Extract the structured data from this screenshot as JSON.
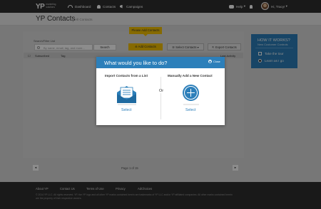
{
  "app": {
    "logo": "YP",
    "logo_sub_1": "marketing",
    "logo_sub_2": "solutions"
  },
  "nav": {
    "items": [
      {
        "label": "Dashboard",
        "icon": "dashboard-icon"
      },
      {
        "label": "Contacts",
        "icon": "contacts-icon"
      },
      {
        "label": "Campaigns",
        "icon": "campaigns-icon"
      }
    ],
    "help": "Help",
    "user": "Hi, Tracy!"
  },
  "header": {
    "title": "YP Contacts",
    "breadcrumb": "All Contacts"
  },
  "toolbar": {
    "search_label": "Search/Filter List",
    "search_placeholder": "By name, email, tag, and more...",
    "search_button": "Search",
    "tooltip": "Please Add Contacts",
    "add_button": "Add Contacts",
    "select_button": "Select Contacts",
    "export_button": "Export Contacts"
  },
  "table": {
    "columns": [
      "Subscribed",
      "Tag",
      "Last Activity"
    ]
  },
  "pager": {
    "prev": "◄",
    "next": "►",
    "text": "Page 1 of 15"
  },
  "helper": {
    "title": "HOW IT WORKS?",
    "subtitle": "New Customer Controls",
    "options": [
      "Take the tour",
      "Learn as I go"
    ]
  },
  "footer": {
    "links": [
      "About YP",
      "Contact Us",
      "Terms of Use",
      "Privacy",
      "AdChoices"
    ],
    "legal": "© 2014 YP LLC. All rights reserved. YP, the YP logo and all other YP marks contained herein are trademarks of YP LLC and/or YP affiliated companies. All other marks contained herein are the property of their respective owners."
  },
  "modal": {
    "title": "What would you like to do?",
    "close": "Close",
    "left_heading": "Import Contacts from a List",
    "right_heading": "Manually Add a New Contact",
    "or": "Or",
    "left_action": "Select",
    "right_action": "Select"
  },
  "colors": {
    "brand_blue": "#2c7fba",
    "accent_yellow": "#f5c200",
    "nav_dark": "#2e2e2e"
  }
}
